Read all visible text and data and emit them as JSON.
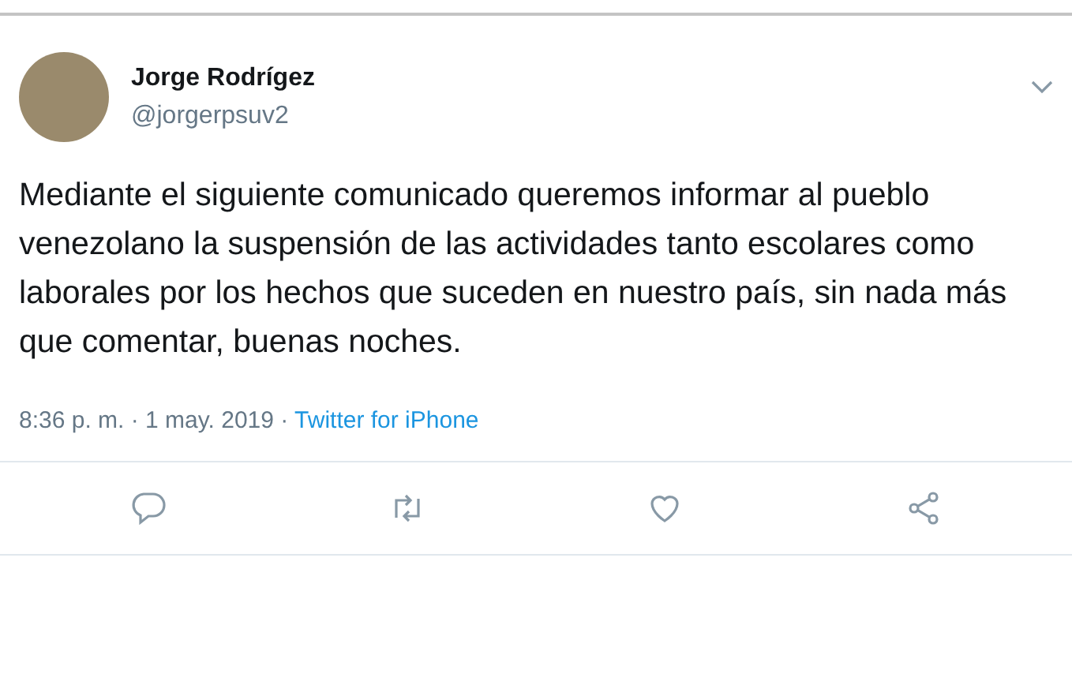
{
  "tweet": {
    "author": {
      "name": "Jorge Rodrígez",
      "handle": "@jorgerpsuv2"
    },
    "text": "Mediante el siguiente comunicado queremos informar al pueblo venezolano la suspensión de las actividades tanto escolares como laborales por los hechos que suceden en nuestro país, sin nada más que comentar, buenas noches.",
    "timestamp": "8:36 p. m. · 1 may. 2019 · ",
    "source": "Twitter for iPhone",
    "actions": [
      {
        "kind": "reply"
      },
      {
        "kind": "retweet"
      },
      {
        "kind": "like"
      },
      {
        "kind": "share"
      }
    ]
  }
}
